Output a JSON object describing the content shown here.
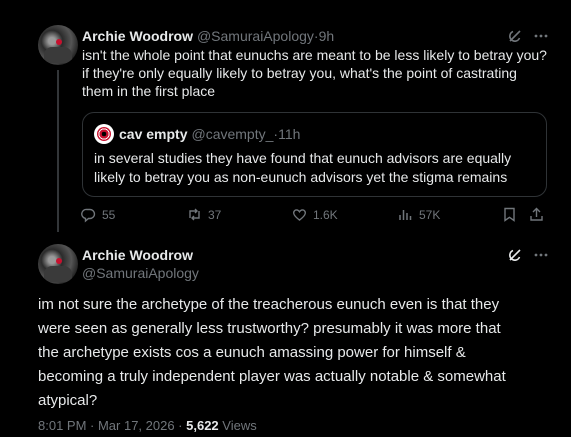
{
  "reply_tweet": {
    "author_name": "Archie Woodrow",
    "author_handle": "@SamuraiApology",
    "separator": " · ",
    "time": "9h",
    "text_lines": [
      "isn't the whole point that eunuchs are meant to be less likely to betray you?",
      "if they're only equally likely to betray you, what's the point of castrating",
      "them in the first place"
    ],
    "quoted": {
      "author_name": "cav empty",
      "author_handle": "@cavempty_",
      "separator": " · ",
      "time": "11h",
      "text_lines": [
        "in several studies they have found that eunuch advisors are equally",
        "likely to betray you as non-eunuch advisors yet the stigma remains"
      ]
    },
    "actions": {
      "replies": "55",
      "reposts": "37",
      "likes": "1.6K",
      "views": "57K"
    }
  },
  "main_tweet": {
    "author_name": "Archie Woodrow",
    "author_handle": "@SamuraiApology",
    "text_lines": [
      "im not sure the archetype of the treacherous eunuch even is that they",
      "were seen as generally less trustworthy? presumably it was more that",
      "the archetype exists cos a eunuch amassing power for himself &",
      "becoming a truly independent player was actually notable & somewhat",
      "atypical?"
    ],
    "timestamp": "8:01 PM · Mar 17, 2026 · ",
    "views_count": "5,622",
    "views_label": " Views"
  },
  "icons": {
    "grok": "grok-icon",
    "more": "more-icon",
    "reply": "reply-icon",
    "repost": "repost-icon",
    "like": "like-icon",
    "views": "views-icon",
    "bookmark": "bookmark-icon",
    "share": "share-icon"
  },
  "colors": {
    "background": "#000000",
    "text": "#e7e9ea",
    "secondary": "#71767b",
    "border": "#2f3336"
  }
}
